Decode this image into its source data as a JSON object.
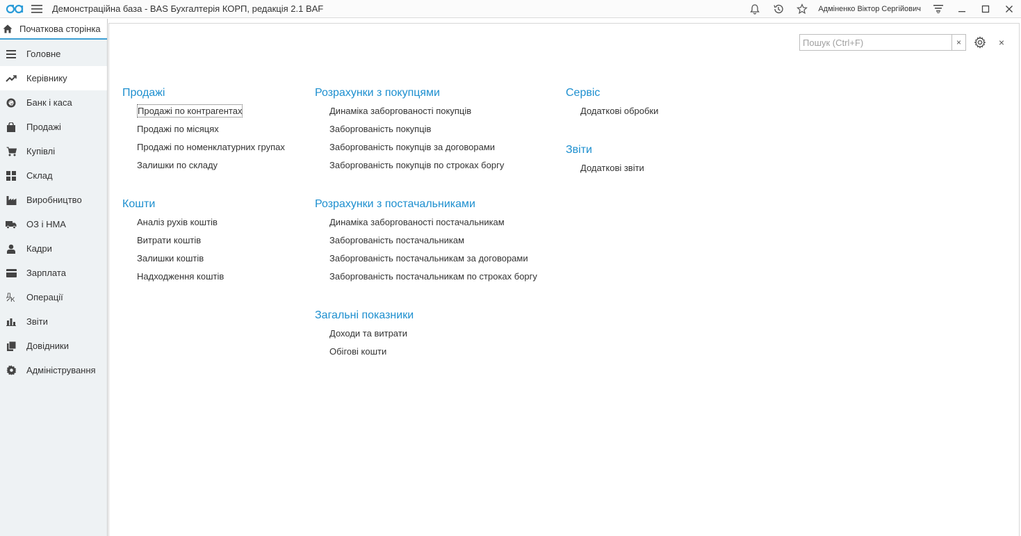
{
  "titlebar": {
    "app_title": "Демонстраційна база - BAS Бухгалтерія КОРП, редакція 2.1 BAF",
    "user_name": "Адміненко Віктор Сергійович",
    "icons": [
      "logo-icon",
      "menu-icon",
      "bell-icon",
      "history-icon",
      "star-icon",
      "filter-menu-icon",
      "minimize-icon",
      "maximize-icon",
      "close-icon"
    ]
  },
  "sidebar": {
    "home_tab": "Початкова сторінка",
    "items": [
      {
        "label": "Головне",
        "icon": "list-icon",
        "active": false
      },
      {
        "label": "Керівнику",
        "icon": "trend-icon",
        "active": true
      },
      {
        "label": "Банк і каса",
        "icon": "bank-icon",
        "active": false
      },
      {
        "label": "Продажі",
        "icon": "bag-icon",
        "active": false
      },
      {
        "label": "Купівлі",
        "icon": "cart-icon",
        "active": false
      },
      {
        "label": "Склад",
        "icon": "grid-icon",
        "active": false
      },
      {
        "label": "Виробництво",
        "icon": "factory-icon",
        "active": false
      },
      {
        "label": "ОЗ і НМА",
        "icon": "truck-icon",
        "active": false
      },
      {
        "label": "Кадри",
        "icon": "person-icon",
        "active": false
      },
      {
        "label": "Зарплата",
        "icon": "card-icon",
        "active": false
      },
      {
        "label": "Операції",
        "icon": "operations-icon",
        "active": false
      },
      {
        "label": "Звіти",
        "icon": "bar-chart-icon",
        "active": false
      },
      {
        "label": "Довідники",
        "icon": "books-icon",
        "active": false
      },
      {
        "label": "Адміністрування",
        "icon": "gear-icon",
        "active": false
      }
    ]
  },
  "main": {
    "search": {
      "placeholder": "Пошук (Ctrl+F)",
      "value": "",
      "clear": "×"
    },
    "close": "×",
    "columns": [
      {
        "groups": [
          {
            "title": "Продажі",
            "links": [
              "Продажі по контрагентах",
              "Продажі по місяцях",
              "Продажі по номенклатурних групах",
              "Залишки по складу"
            ]
          },
          {
            "title": "Кошти",
            "links": [
              "Аналіз рухів коштів",
              "Витрати коштів",
              "Залишки коштів",
              "Надходження коштів"
            ]
          }
        ]
      },
      {
        "groups": [
          {
            "title": "Розрахунки з покупцями",
            "links": [
              "Динаміка заборгованості покупців",
              "Заборгованість покупців",
              "Заборгованість покупців за договорами",
              "Заборгованість покупців по строках боргу"
            ]
          },
          {
            "title": "Розрахунки з постачальниками",
            "links": [
              "Динаміка заборгованості постачальникам",
              "Заборгованість постачальникам",
              "Заборгованість постачальникам за договорами",
              "Заборгованість постачальникам по строках боргу"
            ]
          },
          {
            "title": "Загальні показники",
            "links": [
              "Доходи та витрати",
              "Обігові кошти"
            ]
          }
        ]
      },
      {
        "groups": [
          {
            "title": "Сервіс",
            "links": [
              "Додаткові обробки"
            ]
          },
          {
            "title": "Звіти",
            "links": [
              "Додаткові звіти"
            ]
          }
        ]
      }
    ]
  },
  "colors": {
    "accent": "#1d8fcf",
    "tab_underline": "#3d9fd4",
    "sidebar_bg": "#eef2f4",
    "text": "#333333"
  }
}
